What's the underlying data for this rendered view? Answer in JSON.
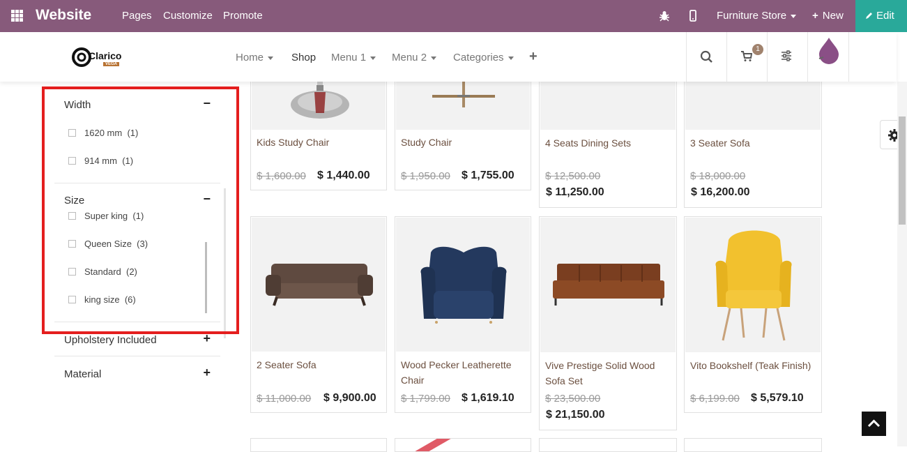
{
  "topbar": {
    "brand": "Website",
    "menu": [
      "Pages",
      "Customize",
      "Promote"
    ],
    "store": "Furniture Store",
    "new_label": "New",
    "edit_label": "Edit",
    "bg_color": "#875a7b",
    "edit_color": "#29a99a"
  },
  "header": {
    "logo_text": "Clarico",
    "logo_sub": "VEGA",
    "nav": [
      "Home",
      "Shop",
      "Menu 1",
      "Menu 2",
      "Categories"
    ],
    "cart_count": "1"
  },
  "sidebar": {
    "width": {
      "title": "Width",
      "options": [
        {
          "label": "1620 mm",
          "count": "(1)"
        },
        {
          "label": "914 mm",
          "count": "(1)"
        }
      ]
    },
    "size": {
      "title": "Size",
      "options": [
        {
          "label": "Super king",
          "count": "(1)"
        },
        {
          "label": "Queen Size",
          "count": "(3)"
        },
        {
          "label": "Standard",
          "count": "(2)"
        },
        {
          "label": "king size",
          "count": "(6)"
        }
      ]
    },
    "upholstery": {
      "title": "Upholstery Included"
    },
    "material": {
      "title": "Material"
    }
  },
  "products": [
    {
      "name": "Kids Study Chair",
      "old": "$ 1,600.00",
      "new": "$ 1,440.00"
    },
    {
      "name": "Study Chair",
      "old": "$ 1,950.00",
      "new": "$ 1,755.00"
    },
    {
      "name": "4 Seats Dining Sets",
      "old": "$ 12,500.00",
      "new": "$ 11,250.00"
    },
    {
      "name": "3 Seater Sofa",
      "old": "$ 18,000.00",
      "new": "$ 16,200.00"
    },
    {
      "name": "2 Seater Sofa",
      "old": "$ 11,000.00",
      "new": "$ 9,900.00"
    },
    {
      "name": "Wood Pecker Leatherette Chair",
      "old": "$ 1,799.00",
      "new": "$ 1,619.10"
    },
    {
      "name": "Vive Prestige Solid Wood Sofa Set",
      "old": "$ 23,500.00",
      "new": "$ 21,150.00"
    },
    {
      "name": "Vito Bookshelf (Teak Finish)",
      "old": "$ 6,199.00",
      "new": "$ 5,579.10"
    }
  ]
}
